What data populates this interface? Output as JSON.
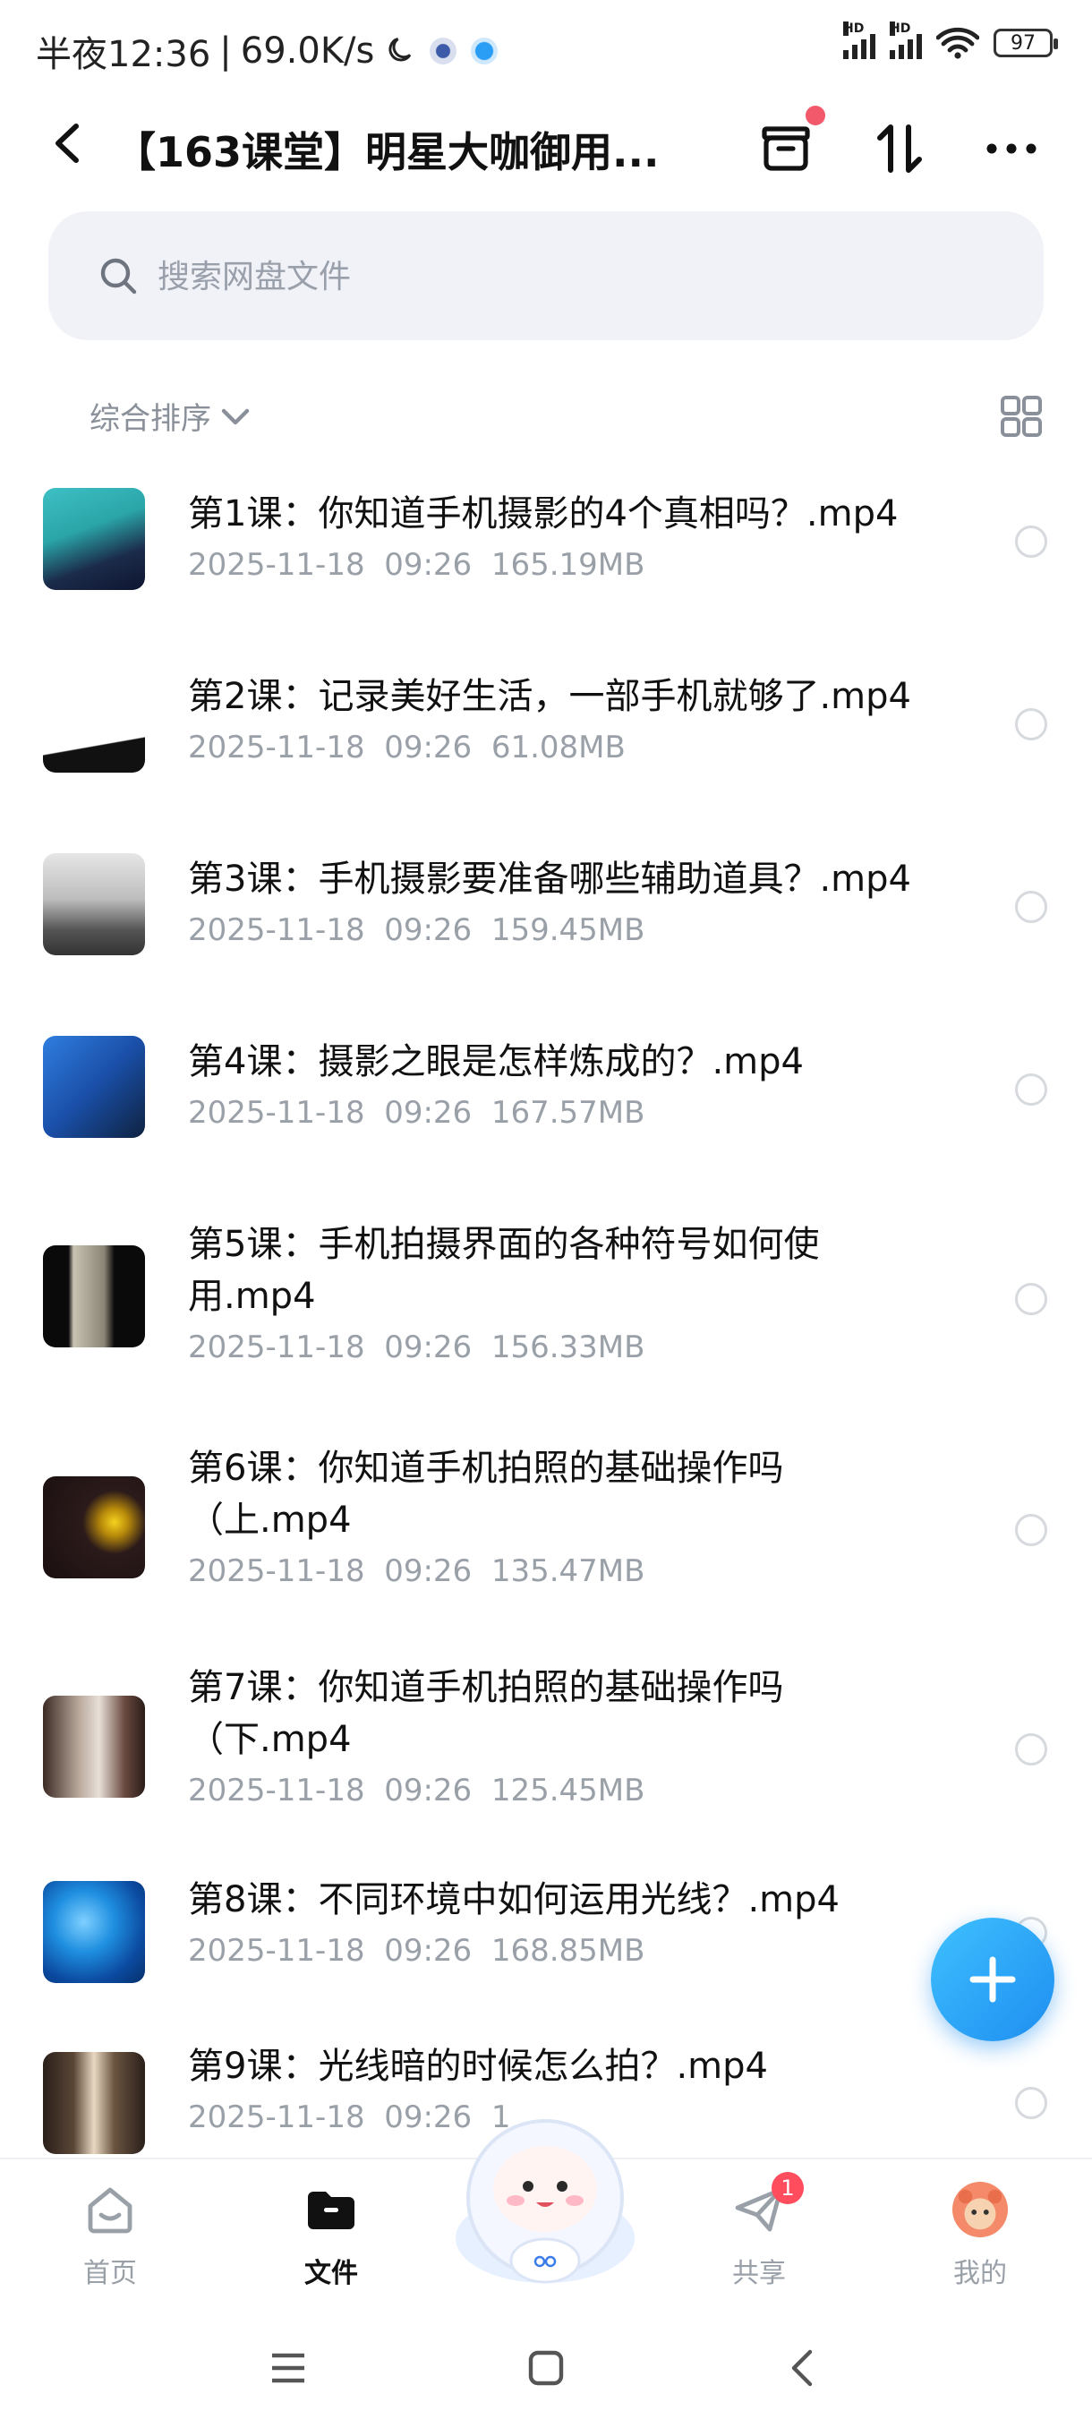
{
  "status_bar": {
    "time": "半夜12:36",
    "speed": "69.0K/s",
    "battery": "97",
    "hd1": "HD",
    "hd2": "HD"
  },
  "header": {
    "back_icon": "chevron-left-icon",
    "title": "【163课堂】明星大咖御用...",
    "archive_icon": "archive-box-icon",
    "sort_icon": "sort-arrows-icon",
    "more_icon": "more-horizontal-icon"
  },
  "search": {
    "placeholder": "搜索网盘文件"
  },
  "sort": {
    "label": "综合排序"
  },
  "files": [
    {
      "name": "第1课：你知道手机摄影的4个真相吗？.mp4",
      "date": "2025-11-18  09:26",
      "size": "165.19MB"
    },
    {
      "name": "第2课：记录美好生活，一部手机就够了.mp4",
      "date": "2025-11-18  09:26",
      "size": "61.08MB"
    },
    {
      "name": "第3课：手机摄影要准备哪些辅助道具？.mp4",
      "date": "2025-11-18  09:26",
      "size": "159.45MB"
    },
    {
      "name": "第4课：摄影之眼是怎样炼成的？.mp4",
      "date": "2025-11-18  09:26",
      "size": "167.57MB"
    },
    {
      "name": "第5课：手机拍摄界面的各种符号如何使用.mp4",
      "date": "2025-11-18  09:26",
      "size": "156.33MB"
    },
    {
      "name": "第6课：你知道手机拍照的基础操作吗（上.mp4",
      "date": "2025-11-18  09:26",
      "size": "135.47MB"
    },
    {
      "name": "第7课：你知道手机拍照的基础操作吗（下.mp4",
      "date": "2025-11-18  09:26",
      "size": "125.45MB"
    },
    {
      "name": "第8课：不同环境中如何运用光线？.mp4",
      "date": "2025-11-18  09:26",
      "size": "168.85MB"
    },
    {
      "name": "第9课：光线暗的时候怎么拍？.mp4",
      "date": "2025-11-18  09:26",
      "size": "1"
    }
  ],
  "tabs": [
    {
      "label": "首页",
      "icon": "home-icon"
    },
    {
      "label": "文件",
      "icon": "folder-icon"
    },
    {
      "label": "共享",
      "icon": "paper-plane-icon",
      "badge": "1"
    },
    {
      "label": "我的",
      "icon": "avatar-icon"
    }
  ],
  "colors": {
    "accent": "#1e8ef0",
    "badge": "#ff4d5e",
    "search_bg": "#f0f2f7",
    "meta_text": "#9aa0a8"
  }
}
